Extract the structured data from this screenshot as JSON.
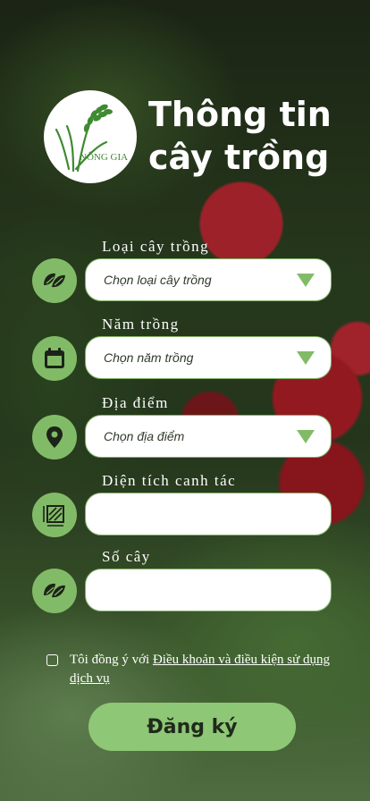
{
  "logo": {
    "text": "NÔNG GIA"
  },
  "header": {
    "title_line1": "Thông tin",
    "title_line2": "cây trồng"
  },
  "form": {
    "crop_type": {
      "label": "Loại cây trồng",
      "placeholder": "Chọn loại cây trồng",
      "icon": "leaf-icon"
    },
    "planting_year": {
      "label": "Năm trồng",
      "placeholder": "Chọn năm trồng",
      "icon": "calendar-icon"
    },
    "location": {
      "label": "Địa điểm",
      "placeholder": "Chọn địa điểm",
      "icon": "location-pin-icon"
    },
    "cultivated_area": {
      "label": "Diện tích canh tác",
      "value": "",
      "icon": "area-icon"
    },
    "tree_count": {
      "label": "Số cây",
      "value": "",
      "icon": "leaf-icon"
    }
  },
  "terms": {
    "prefix": "Tôi đồng ý với ",
    "link": "Điều khoản và điều kiện sử dụng dịch vụ"
  },
  "submit": {
    "label": "Đăng ký"
  },
  "colors": {
    "accent": "#82bb67",
    "button": "#8ec775"
  }
}
